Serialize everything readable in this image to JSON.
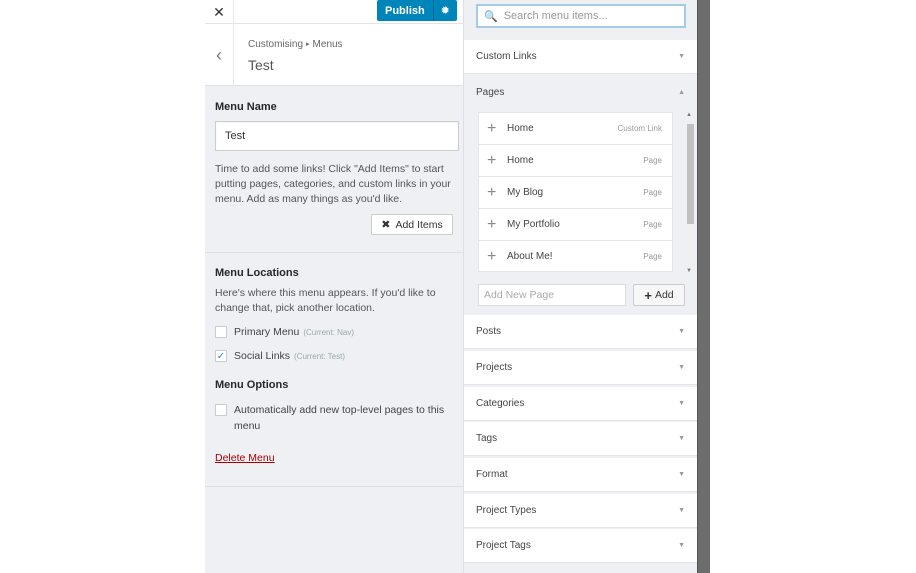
{
  "topbar": {
    "close_label": "✕",
    "publish_label": "Publish",
    "settings_icon": "gear-icon"
  },
  "header": {
    "back_icon": "‹",
    "breadcrumb_root": "Customising",
    "breadcrumb_sep": "▸",
    "breadcrumb_section": "Menus",
    "title": "Test"
  },
  "menu_name": {
    "label": "Menu Name",
    "value": "Test",
    "description": "Time to add some links! Click \"Add Items\" to start putting pages, categories, and custom links in your menu. Add as many things as you'd like.",
    "add_items_label": "Add Items"
  },
  "menu_locations": {
    "label": "Menu Locations",
    "description": "Here's where this menu appears. If you'd like to change that, pick another location.",
    "items": [
      {
        "label": "Primary Menu",
        "hint": "(Current: Nav)",
        "checked": false
      },
      {
        "label": "Social Links",
        "hint": "(Current: Test)",
        "checked": true
      }
    ]
  },
  "menu_options": {
    "label": "Menu Options",
    "auto_add_label": "Automatically add new top-level pages to this menu",
    "auto_add_checked": false
  },
  "delete_label": "Delete Menu",
  "panel": {
    "search_placeholder": "Search menu items...",
    "sections": [
      "Custom Links",
      "Pages",
      "Posts",
      "Projects",
      "Categories",
      "Tags",
      "Format",
      "Project Types",
      "Project Tags"
    ],
    "pages_items": [
      {
        "name": "Home",
        "type": "Custom Link"
      },
      {
        "name": "Home",
        "type": "Page"
      },
      {
        "name": "My Blog",
        "type": "Page"
      },
      {
        "name": "My Portfolio",
        "type": "Page"
      },
      {
        "name": "About Me!",
        "type": "Page"
      }
    ],
    "new_page_placeholder": "Add New Page",
    "add_label": "Add"
  }
}
